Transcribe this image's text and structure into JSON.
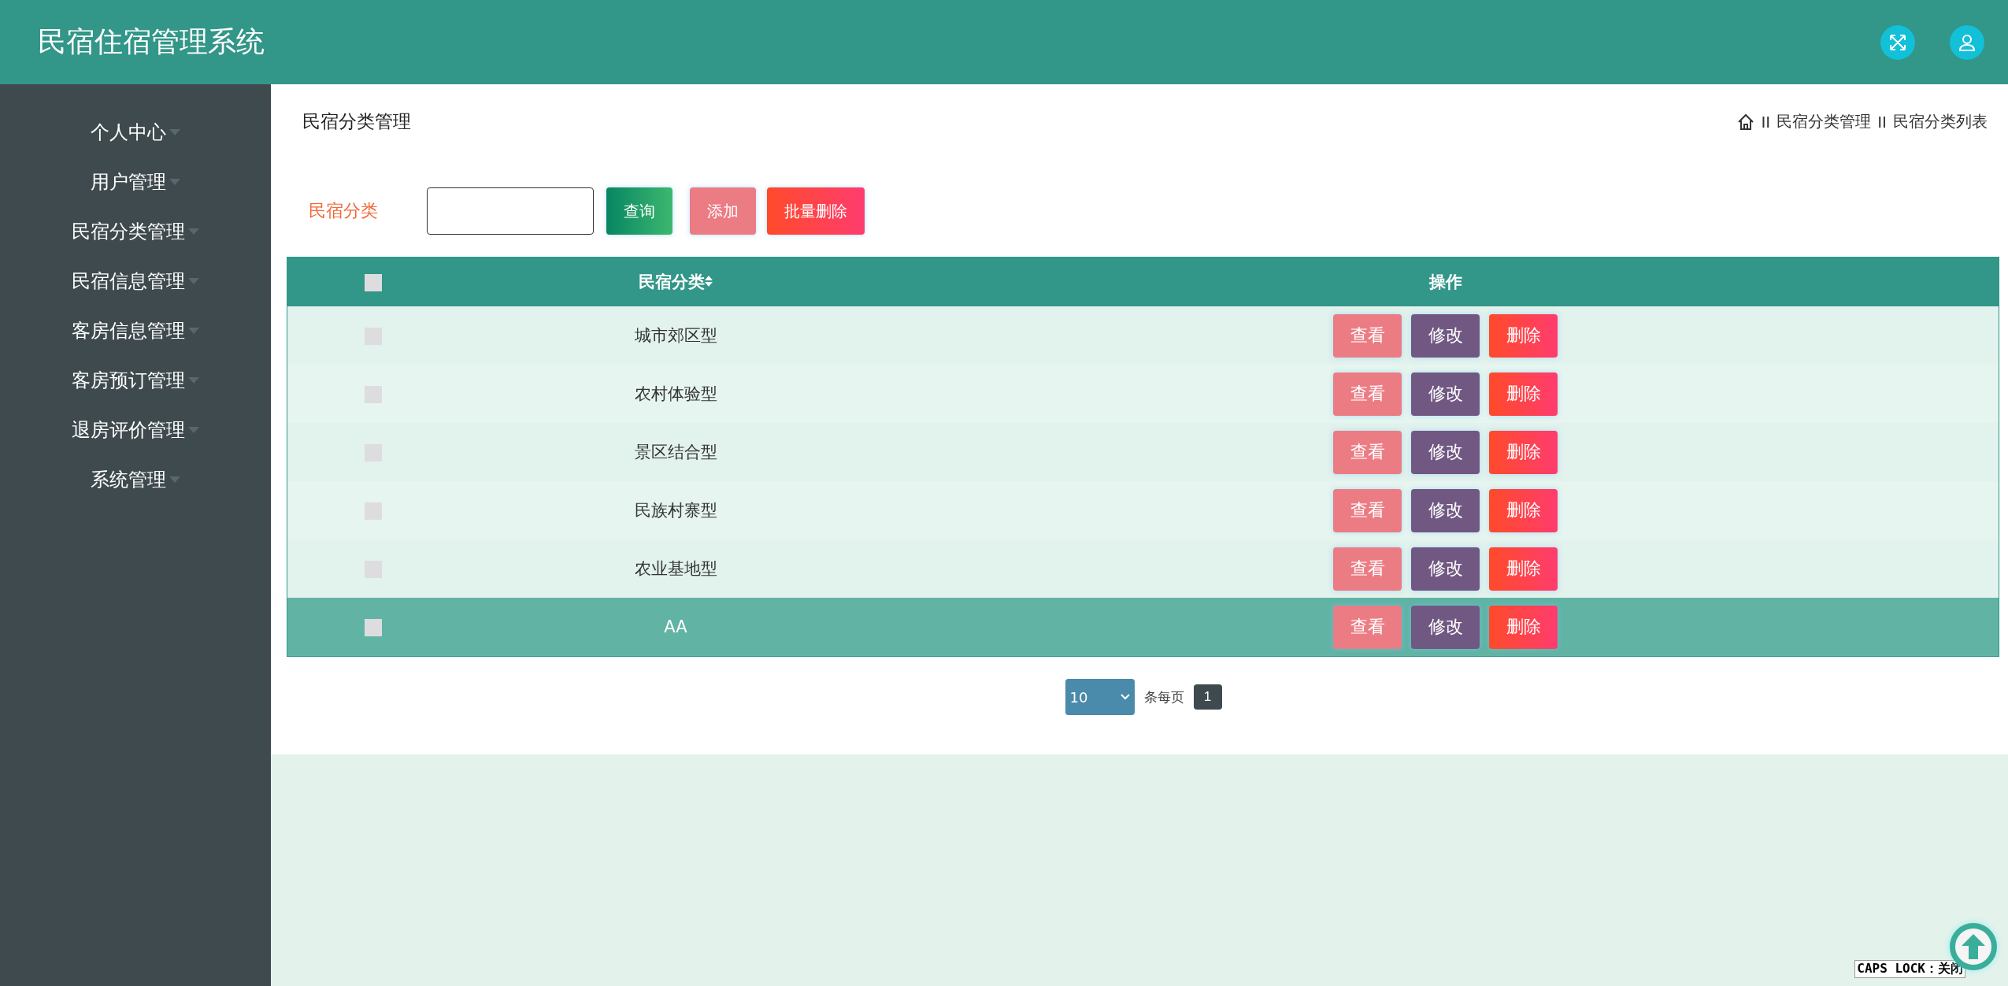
{
  "header": {
    "title": "民宿住宿管理系统"
  },
  "sidebar": {
    "items": [
      {
        "label": "个人中心"
      },
      {
        "label": "用户管理"
      },
      {
        "label": "民宿分类管理"
      },
      {
        "label": "民宿信息管理"
      },
      {
        "label": "客房信息管理"
      },
      {
        "label": "客房预订管理"
      },
      {
        "label": "退房评价管理"
      },
      {
        "label": "系统管理"
      }
    ]
  },
  "page": {
    "title": "民宿分类管理",
    "breadcrumb": [
      "II",
      "民宿分类管理",
      "II",
      "民宿分类列表"
    ]
  },
  "search": {
    "label": "民宿分类",
    "buttons": [
      {
        "label": "查询",
        "kind": "query"
      },
      {
        "label": "添加",
        "kind": "add"
      },
      {
        "label": "批量删除",
        "kind": "batch-delete"
      }
    ]
  },
  "table": {
    "select_all_checked": false,
    "columns": [
      "民宿分类",
      "操作"
    ],
    "rows": [
      {
        "category": "城市郊区型",
        "checked": false,
        "hovered": false,
        "actions": [
          {
            "label": "查看",
            "kind": "view"
          },
          {
            "label": "修改",
            "kind": "edit"
          },
          {
            "label": "删除",
            "kind": "delete"
          }
        ]
      },
      {
        "category": "农村体验型",
        "checked": false,
        "hovered": false,
        "actions": [
          {
            "label": "查看",
            "kind": "view"
          },
          {
            "label": "修改",
            "kind": "edit"
          },
          {
            "label": "删除",
            "kind": "delete"
          }
        ]
      },
      {
        "category": "景区结合型",
        "checked": false,
        "hovered": false,
        "actions": [
          {
            "label": "查看",
            "kind": "view"
          },
          {
            "label": "修改",
            "kind": "edit"
          },
          {
            "label": "删除",
            "kind": "delete"
          }
        ]
      },
      {
        "category": "民族村寨型",
        "checked": false,
        "hovered": false,
        "actions": [
          {
            "label": "查看",
            "kind": "view"
          },
          {
            "label": "修改",
            "kind": "edit"
          },
          {
            "label": "删除",
            "kind": "delete"
          }
        ]
      },
      {
        "category": "农业基地型",
        "checked": false,
        "hovered": false,
        "actions": [
          {
            "label": "查看",
            "kind": "view"
          },
          {
            "label": "修改",
            "kind": "edit"
          },
          {
            "label": "删除",
            "kind": "delete"
          }
        ]
      },
      {
        "category": "AA",
        "checked": false,
        "hovered": true,
        "actions": [
          {
            "label": "查看",
            "kind": "view"
          },
          {
            "label": "修改",
            "kind": "edit"
          },
          {
            "label": "删除",
            "kind": "delete"
          }
        ]
      }
    ]
  },
  "pagination": {
    "page_size": "10",
    "page_size_label": "条每页",
    "pages": [
      {
        "label": "1",
        "selected": true
      }
    ]
  },
  "caps_lock": "CAPS LOCK：关闭"
}
